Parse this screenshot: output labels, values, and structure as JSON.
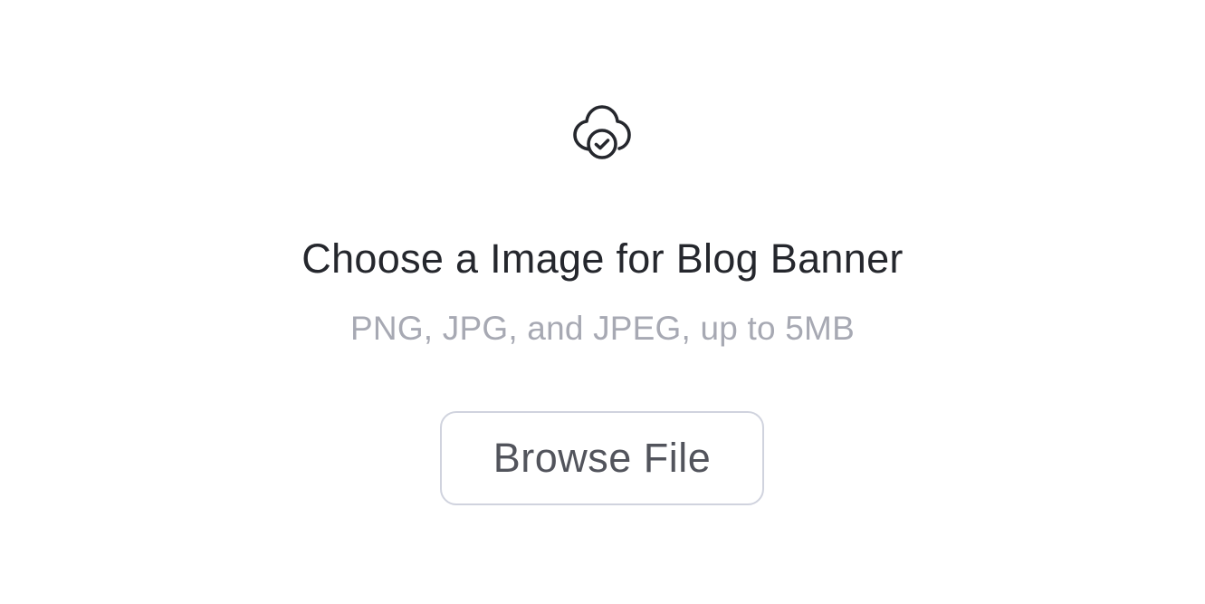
{
  "upload": {
    "icon": "cloud-check-icon",
    "title": "Choose a Image for Blog Banner",
    "subtitle": "PNG, JPG, and JPEG, up to 5MB",
    "browse_label": "Browse File"
  },
  "colors": {
    "title": "#25272d",
    "subtitle": "#a7a9b3",
    "button_text": "#52545c",
    "button_border": "#d0d3de",
    "icon": "#25272d",
    "background": "#ffffff"
  }
}
